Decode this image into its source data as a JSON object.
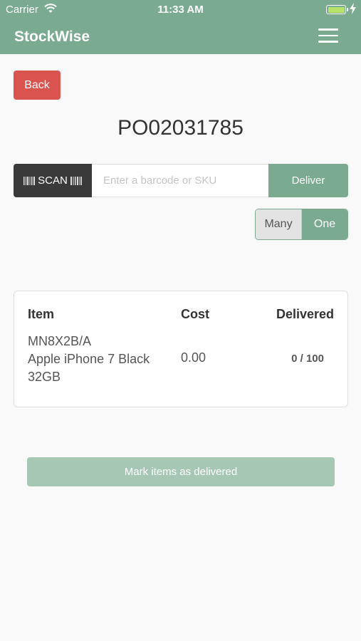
{
  "status_bar": {
    "carrier": "Carrier",
    "time": "11:33 AM",
    "icons": [
      "wifi-icon",
      "battery-icon",
      "charging-bolt-icon"
    ],
    "battery_color": "#b7e36b"
  },
  "navbar": {
    "title": "StockWise",
    "menu_icon": "hamburger-menu-icon"
  },
  "back_label": "Back",
  "po_number": "PO02031785",
  "scan": {
    "button_label": "SCAN",
    "icon": "barcode-icon",
    "placeholder": "Enter a barcode or SKU",
    "value": "",
    "deliver_label": "Deliver"
  },
  "quantity_mode": {
    "options": [
      "Many",
      "One"
    ],
    "selected": "One"
  },
  "items_table": {
    "headers": {
      "item": "Item",
      "cost": "Cost",
      "delivered": "Delivered"
    },
    "rows": [
      {
        "sku": "MN8X2B/A",
        "name": "Apple iPhone 7 Black 32GB",
        "cost": "0.00",
        "delivered": "0 / 100"
      }
    ]
  },
  "mark_delivered_label": "Mark items as delivered",
  "colors": {
    "primary": "#7aaa8f",
    "danger": "#d9534f",
    "scan_dark": "#3a3a3a",
    "disabled_primary": "#a7c7b5",
    "background": "#f9f9f9"
  }
}
